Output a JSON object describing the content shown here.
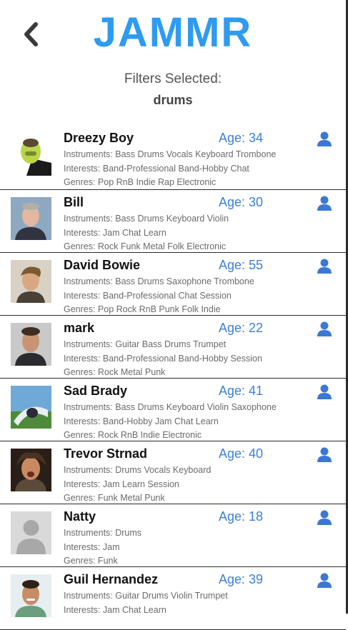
{
  "app": {
    "logo_text": "JAMMR"
  },
  "filters": {
    "label": "Filters Selected:",
    "value": "drums"
  },
  "users": [
    {
      "name": "Dreezy Boy",
      "age": "Age: 34",
      "instruments": "Instruments: Bass Drums Vocals Keyboard Trombone",
      "interests": "Interests: Band-Professional Band-Hobby Chat",
      "genres": "Genres: Pop RnB Indie Rap Electronic"
    },
    {
      "name": "Bill",
      "age": "Age: 30",
      "instruments": "Instruments: Bass Drums Keyboard Violin",
      "interests": "Interests: Jam Chat Learn",
      "genres": "Genres: Rock Funk Metal Folk Electronic"
    },
    {
      "name": "David Bowie",
      "age": "Age: 55",
      "instruments": "Instruments: Bass Drums Saxophone Trombone",
      "interests": "Interests: Band-Professional Chat Session",
      "genres": "Genres: Pop Rock RnB Punk Folk Indie"
    },
    {
      "name": "mark",
      "age": "Age: 22",
      "instruments": "Instruments: Guitar Bass Drums Trumpet",
      "interests": "Interests: Band-Professional Band-Hobby Session",
      "genres": "Genres: Rock Metal Punk"
    },
    {
      "name": "Sad Brady",
      "age": "Age: 41",
      "instruments": "Instruments: Bass Drums Keyboard Violin Saxophone",
      "interests": "Interests: Band-Hobby Jam Chat Learn",
      "genres": "Genres: Rock RnB Indie Electronic"
    },
    {
      "name": "Trevor Strnad",
      "age": "Age: 40",
      "instruments": "Instruments: Drums Vocals Keyboard",
      "interests": "Interests: Jam Learn Session",
      "genres": "Genres: Funk Metal Punk"
    },
    {
      "name": "Natty",
      "age": "Age: 18",
      "instruments": "Instruments: Drums",
      "interests": "Interests: Jam",
      "genres": "Genres: Funk"
    },
    {
      "name": "Guil Hernandez",
      "age": "Age: 39",
      "instruments": "Instruments: Guitar Drums Violin Trumpet",
      "interests": "Interests: Jam Chat Learn",
      "genres": ""
    }
  ],
  "colors": {
    "brand": "#2e9bf0",
    "age_text": "#3c7fd8",
    "profile_icon": "#3a78d6"
  },
  "icons": {
    "back": "chevron-left-icon",
    "profile": "user-icon"
  }
}
